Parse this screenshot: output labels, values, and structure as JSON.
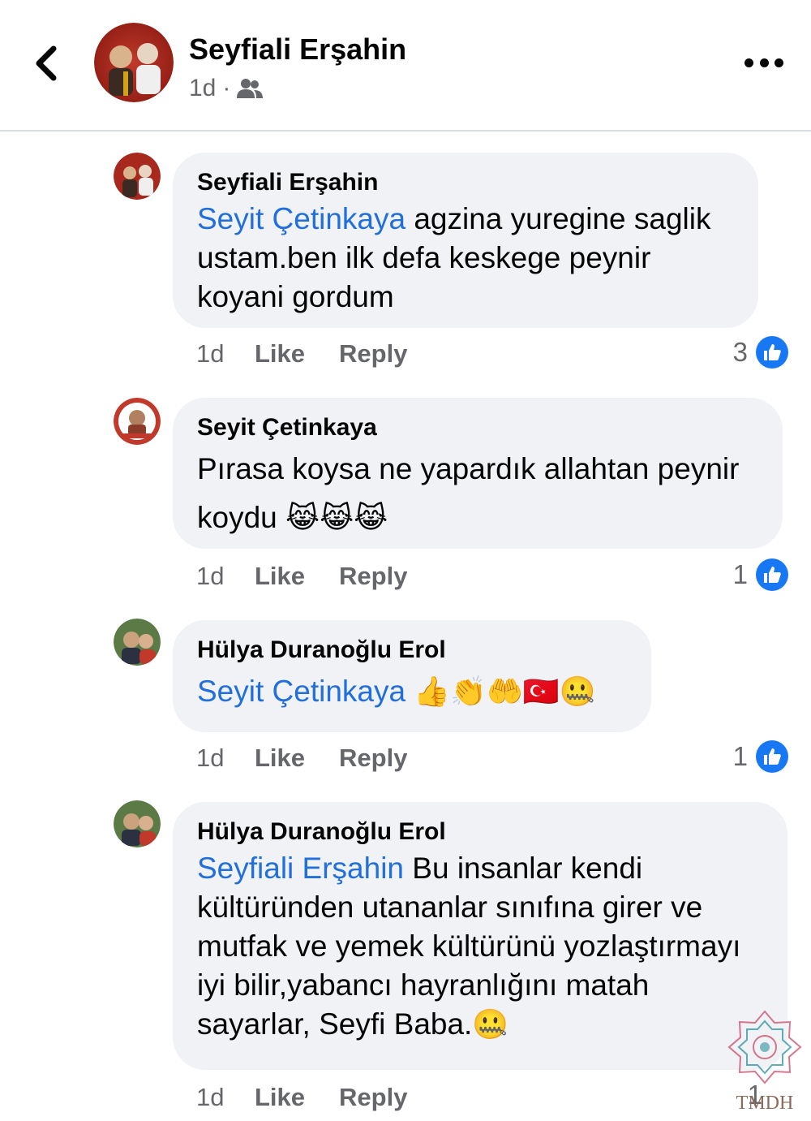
{
  "header": {
    "name": "Seyfiali Erşahin",
    "time": "1d",
    "separator": "·",
    "audience_icon": "friends-icon",
    "back_icon": "chevron-left-icon",
    "more_icon": "more-horizontal-icon"
  },
  "comments": [
    {
      "author": "Seyfiali Erşahin",
      "mention": "Seyit Çetinkaya",
      "text": " agzina yuregine saglik ustam.ben ilk defa keskege  peynir koyani gordum",
      "emoji": "",
      "time": "1d",
      "like_label": "Like",
      "reply_label": "Reply",
      "reaction_count": "3"
    },
    {
      "author": "Seyit Çetinkaya",
      "mention": "",
      "text": "Pırasa koysa ne yapardık allahtan peynir koydu ",
      "emoji": "😹😹😹",
      "time": "1d",
      "like_label": "Like",
      "reply_label": "Reply",
      "reaction_count": "1"
    },
    {
      "author": "Hülya Duranoğlu Erol",
      "mention": "Seyit Çetinkaya",
      "text": " ",
      "emoji": "👍👏🤲🇹🇷🤐",
      "time": "1d",
      "like_label": "Like",
      "reply_label": "Reply",
      "reaction_count": "1"
    },
    {
      "author": "Hülya Duranoğlu Erol",
      "mention": "Seyfiali Erşahin",
      "text": " Bu insanlar kendi kültüründen utananlar sınıfına girer ve mutfak ve yemek kültürünü yozlaştırmayı iyi bilir,yabancı hayranlığını matah sayarlar, Seyfi Baba.",
      "emoji": "🤐",
      "time": "1d",
      "like_label": "Like",
      "reply_label": "Reply",
      "reaction_count": "1"
    }
  ],
  "watermark": {
    "text": "TMDH"
  },
  "colors": {
    "mention": "#216fdb",
    "like_badge": "#1877f2",
    "bubble_bg": "#f0f2f5",
    "meta_text": "#65676b"
  }
}
